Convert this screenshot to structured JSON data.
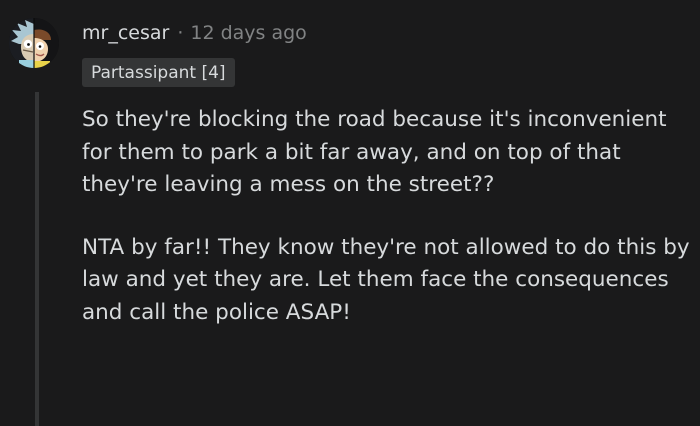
{
  "comment": {
    "author": "mr_cesar",
    "separator": "·",
    "timestamp": "12 days ago",
    "flair": "Partassipant [4]",
    "avatar_icon": "rick-and-morty-avatar-icon",
    "paragraphs": [
      "So they're blocking the road because it's inconvenient for them to park a bit far away, and on top of that they're leaving a mess on the street??",
      "NTA by far!! They know they're not allowed to do this by law and yet they are. Let them face the consequences and call the police ASAP!"
    ]
  },
  "colors": {
    "background": "#1a1a1b",
    "text": "#d7dadc",
    "meta": "#818384",
    "flair_bg": "#343536",
    "thread_line": "#343536"
  }
}
